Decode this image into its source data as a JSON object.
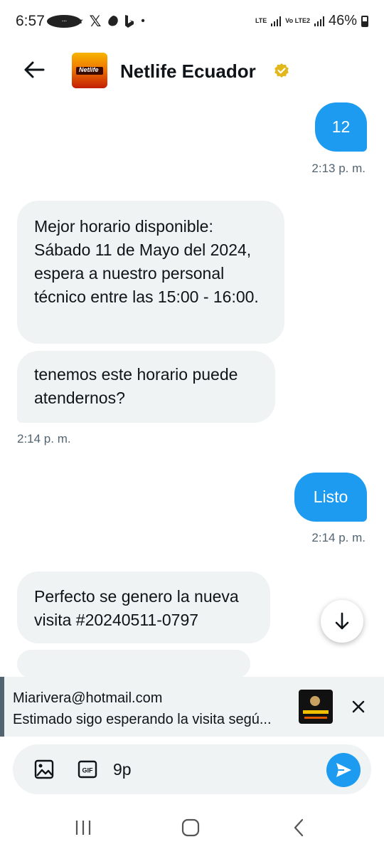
{
  "status_bar": {
    "time": "6:57",
    "notification_icons": [
      "chat-bubble-icon",
      "telegram-icon",
      "uber-icon",
      "x-icon",
      "app-icon",
      "bing-icon",
      "more-dot-icon"
    ],
    "uber_label": "Uber",
    "network_1": "LTE",
    "network_2": "Vo LTE2",
    "battery_percent": "46%"
  },
  "header": {
    "contact_name": "Netlife Ecuador",
    "avatar_label": "Netlife",
    "verified_color": "#e2b719"
  },
  "messages": [
    {
      "direction": "out",
      "text": "12",
      "time": "2:13 p. m."
    },
    {
      "direction": "in",
      "text": "Mejor horario disponible: Sábado 11 de Mayo del 2024, espera a nuestro personal técnico entre las 15:00 - 16:00."
    },
    {
      "direction": "in",
      "text": "tenemos este horario puede atendernos?",
      "time": "2:14 p. m."
    },
    {
      "direction": "out",
      "text": "Listo",
      "time": "2:14 p. m."
    },
    {
      "direction": "in",
      "text": "Perfecto se genero la nueva visita #20240511-0797"
    },
    {
      "direction": "in",
      "text": "",
      "partial": true
    }
  ],
  "reply_preview": {
    "author": "Miarivera@hotmail.com",
    "text": "Estimado sigo esperando la visita segú..."
  },
  "composer": {
    "value": "9p",
    "gif_label": "GIF"
  },
  "colors": {
    "accent": "#1d9bf0",
    "incoming_bubble": "#eff3f4",
    "text_primary": "#0f1419",
    "text_secondary": "#536471"
  }
}
